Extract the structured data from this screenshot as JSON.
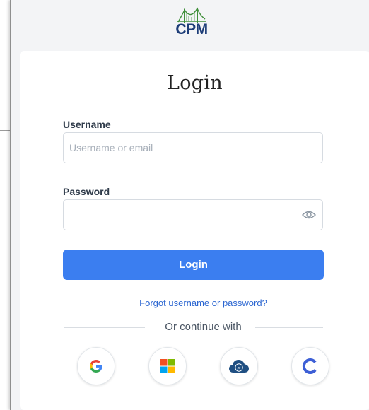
{
  "logo": {
    "text": "CPM"
  },
  "login": {
    "title": "Login",
    "username_label": "Username",
    "username_placeholder": "Username or email",
    "username_value": "",
    "password_label": "Password",
    "password_value": "",
    "submit_label": "Login",
    "forgot_link": "Forgot username or password?",
    "divider_text": "Or continue with"
  },
  "social": [
    {
      "icon": "google-icon"
    },
    {
      "icon": "microsoft-icon"
    },
    {
      "icon": "cloud-ed-icon"
    },
    {
      "icon": "c-icon"
    }
  ],
  "colors": {
    "primary_button": "#3b7ef0",
    "link": "#2b66d1",
    "brand": "#1d3d78",
    "bridge": "#3f8f3a"
  }
}
